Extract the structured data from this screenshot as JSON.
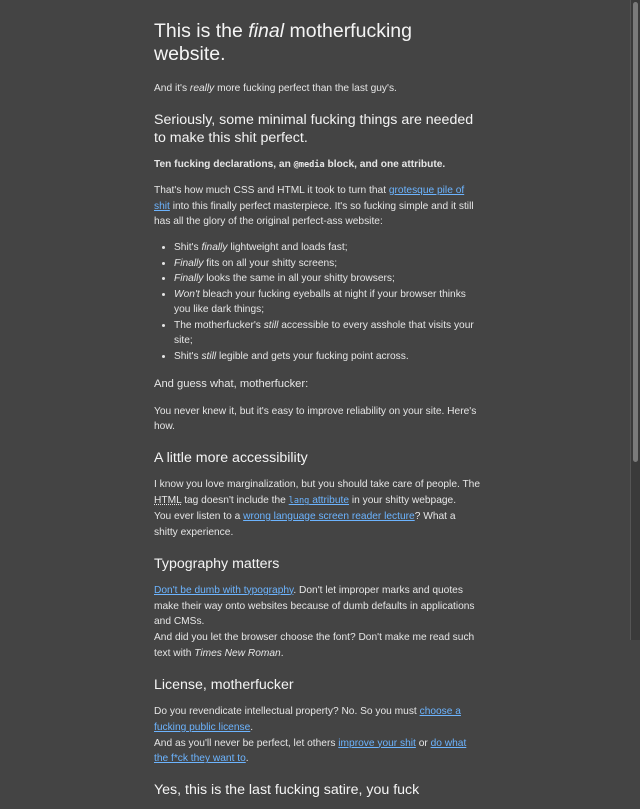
{
  "h1": {
    "pre": "This is the ",
    "em": "final",
    "post": " motherfucking website."
  },
  "intro": {
    "pre": "And it's ",
    "em": "really",
    "post": " more fucking perfect than the last guy's."
  },
  "s1": {
    "heading": "Seriously, some minimal fucking things are needed to make this shit perfect.",
    "bold": {
      "pre": "Ten fucking declarations, an ",
      "code": "@media",
      "post": " block, and one attribute."
    },
    "para": {
      "pre": "That's how much CSS and HTML it took to turn that ",
      "link": "grotesque pile of shit",
      "post": " into this finally perfect masterpiece. It's so fucking simple and it still has all the glory of the original perfect-ass website:"
    },
    "list": [
      {
        "pre": "Shit's ",
        "em": "finally",
        "post": " lightweight and loads fast;"
      },
      {
        "pre": "",
        "em": "Finally",
        "post": " fits on all your shitty screens;"
      },
      {
        "pre": "",
        "em": "Finally",
        "post": " looks the same in all your shitty browsers;"
      },
      {
        "pre": "",
        "em": "Won't",
        "post": " bleach your fucking eyeballs at night if your browser thinks you like dark things;"
      },
      {
        "pre": "The motherfucker's ",
        "em": "still",
        "post": " accessible to every asshole that visits your site;"
      },
      {
        "pre": "Shit's ",
        "em": "still",
        "post": " legible and gets your fucking point across."
      }
    ],
    "guess": "And guess what, motherfucker:",
    "never": "You never knew it, but it's easy to improve reliability on your site. Here's how."
  },
  "s2": {
    "heading": "A little more accessibility",
    "p1_pre": "I know you love marginalization, but you should take care of people. The ",
    "p1_abbr": "HTML",
    "p1_mid": " tag doesn't include the ",
    "p1_link_code": "lang",
    "p1_link_text": " attribute",
    "p1_post": " in your shitty webpage.",
    "p2_pre": "You ever listen to a ",
    "p2_link": "wrong language screen reader lecture",
    "p2_post": "? What a shitty experience."
  },
  "s3": {
    "heading": "Typography matters",
    "link": "Don't be dumb with typography",
    "p1_post": ". Don't let improper marks and quotes make their way onto websites because of dumb defaults in applications and CMSs.",
    "p2_pre": "And did you let the browser choose the font? Don't make me read such text with ",
    "p2_em": "Times New Roman",
    "p2_post": "."
  },
  "s4": {
    "heading": "License, motherfucker",
    "p1_pre": "Do you revendicate intellectual property? No. So you must ",
    "p1_link": "choose a fucking public license",
    "p1_post": ".",
    "p2_pre": "And as you'll never be perfect, let others ",
    "p2_link1": "improve your shit",
    "p2_mid": " or ",
    "p2_link2": "do what the f*ck they want to",
    "p2_post": "."
  },
  "s5": {
    "heading": "Yes, this is the last fucking satire, you fuck"
  }
}
